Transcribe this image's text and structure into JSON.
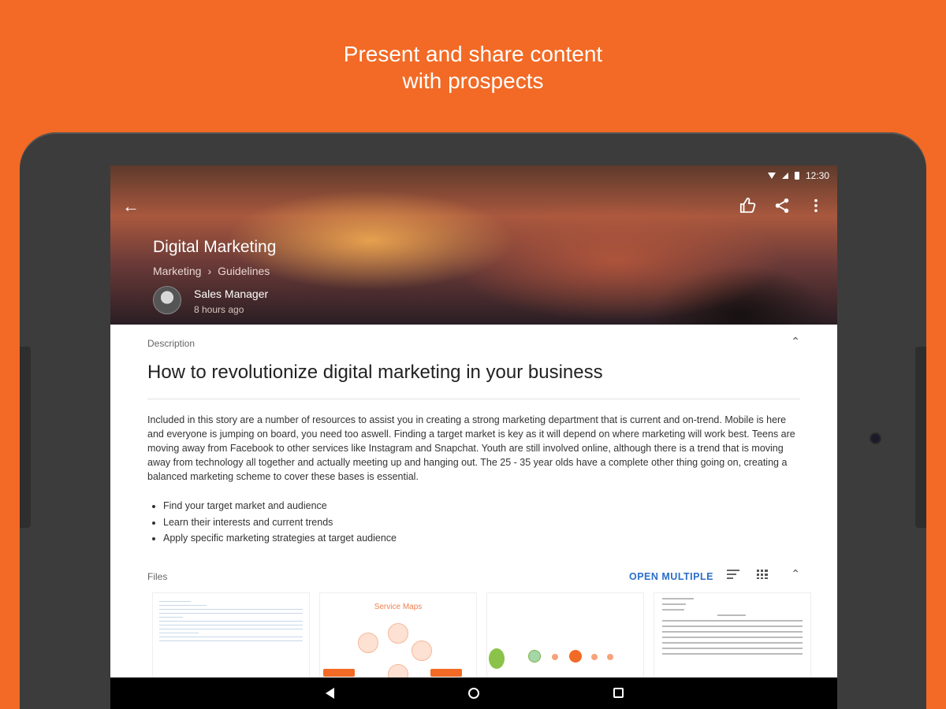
{
  "headline": {
    "line1": "Present and share content",
    "line2": "with prospects"
  },
  "status_bar": {
    "time": "12:30"
  },
  "header": {
    "title": "Digital Marketing",
    "breadcrumb": [
      "Marketing",
      "Guidelines"
    ],
    "author": "Sales Manager",
    "timestamp": "8 hours ago",
    "icons": {
      "back": "arrow-back-icon",
      "like": "thumbs-up-icon",
      "share": "share-icon",
      "more": "more-vert-icon"
    }
  },
  "description": {
    "label": "Description",
    "heading": "How to revolutionize digital marketing in your business",
    "body": "Included in this story are a number of resources to assist you in creating a strong marketing department that is current and on-trend. Mobile is here and everyone is jumping on board, you need too aswell. Finding a target market is key as it will depend on where marketing will work best. Teens are moving away from Facebook to other services like Instagram and Snapchat. Youth are still involved online, although there is a trend that is moving away from technology all together and actually meeting up and hanging out. The 25 - 35 year olds have a complete other thing going on, creating a balanced marketing scheme to cover these bases is essential.",
    "bullets": [
      "Find your target market and audience",
      "Learn their interests and current trends",
      "Apply specific marketing strategies at target audience"
    ]
  },
  "files": {
    "label": "Files",
    "open_multiple": "OPEN MULTIPLE",
    "thumbnails": [
      {
        "title": ""
      },
      {
        "title": "Service Maps"
      },
      {
        "title": ""
      },
      {
        "title": ""
      }
    ]
  },
  "colors": {
    "brand_orange": "#f26a25",
    "link_blue": "#2a6fc9"
  }
}
